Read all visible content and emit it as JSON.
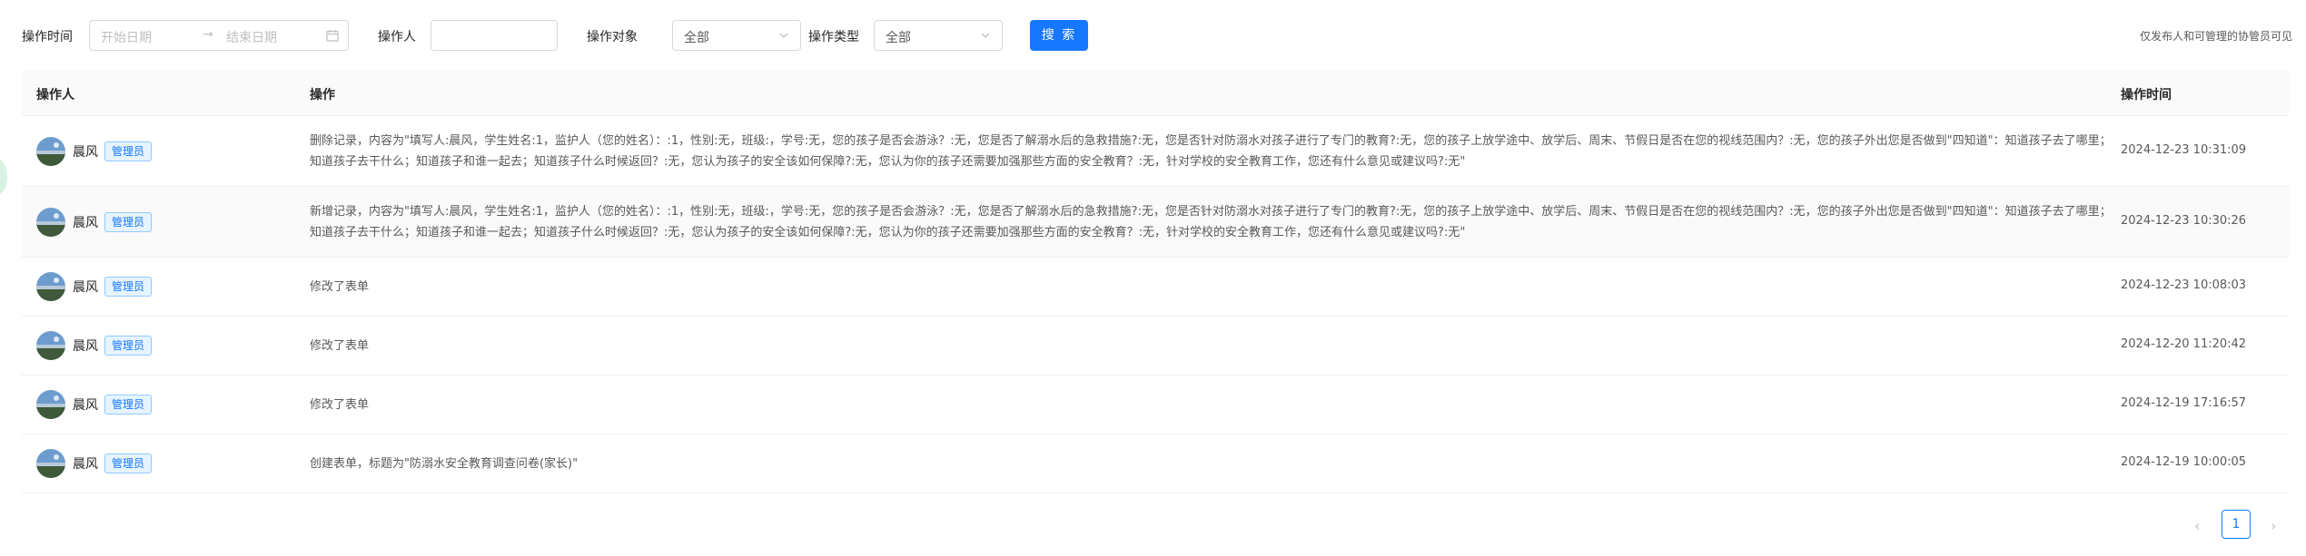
{
  "filters": {
    "time_label": "操作时间",
    "start_placeholder": "开始日期",
    "end_placeholder": "结束日期",
    "operator_label": "操作人",
    "operator_value": "",
    "target_label": "操作对象",
    "target_value": "全部",
    "type_label": "操作类型",
    "type_value": "全部",
    "search_button": "搜 索",
    "note": "仅发布人和可管理的协管员可见"
  },
  "table": {
    "headers": {
      "operator": "操作人",
      "operation": "操作",
      "time": "操作时间"
    },
    "rows": [
      {
        "name": "晨风",
        "role": "管理员",
        "operation": "删除记录，内容为\"填写人:晨风，学生姓名:1，监护人（您的姓名）：:1，性别:无，班级:，学号:无，您的孩子是否会游泳？:无，您是否了解溺水后的急救措施?:无，您是否针对防溺水对孩子进行了专门的教育?:无，您的孩子上放学途中、放学后、周末、节假日是否在您的视线范围内？:无，您的孩子外出您是否做到\"四知道\"：知道孩子去了哪里；知道孩子去干什么；知道孩子和谁一起去；知道孩子什么时候返回？:无，您认为孩子的安全该如何保障?:无，您认为你的孩子还需要加强那些方面的安全教育？:无，针对学校的安全教育工作，您还有什么意见或建议吗?:无\"",
        "time": "2024-12-23 10:31:09"
      },
      {
        "name": "晨风",
        "role": "管理员",
        "operation": "新增记录，内容为\"填写人:晨风，学生姓名:1，监护人（您的姓名）：:1，性别:无，班级:，学号:无，您的孩子是否会游泳？:无，您是否了解溺水后的急救措施?:无，您是否针对防溺水对孩子进行了专门的教育?:无，您的孩子上放学途中、放学后、周末、节假日是否在您的视线范围内？:无，您的孩子外出您是否做到\"四知道\"：知道孩子去了哪里；知道孩子去干什么；知道孩子和谁一起去；知道孩子什么时候返回？:无，您认为孩子的安全该如何保障?:无，您认为你的孩子还需要加强那些方面的安全教育？:无，针对学校的安全教育工作，您还有什么意见或建议吗?:无\"",
        "time": "2024-12-23 10:30:26"
      },
      {
        "name": "晨风",
        "role": "管理员",
        "operation": "修改了表单",
        "time": "2024-12-23 10:08:03"
      },
      {
        "name": "晨风",
        "role": "管理员",
        "operation": "修改了表单",
        "time": "2024-12-20 11:20:42"
      },
      {
        "name": "晨风",
        "role": "管理员",
        "operation": "修改了表单",
        "time": "2024-12-19 17:16:57"
      },
      {
        "name": "晨风",
        "role": "管理员",
        "operation": "创建表单，标题为\"防溺水安全教育调查问卷(家长)\"",
        "time": "2024-12-19 10:00:05"
      }
    ]
  },
  "pagination": {
    "prev": "‹",
    "current": "1",
    "next": "›"
  }
}
